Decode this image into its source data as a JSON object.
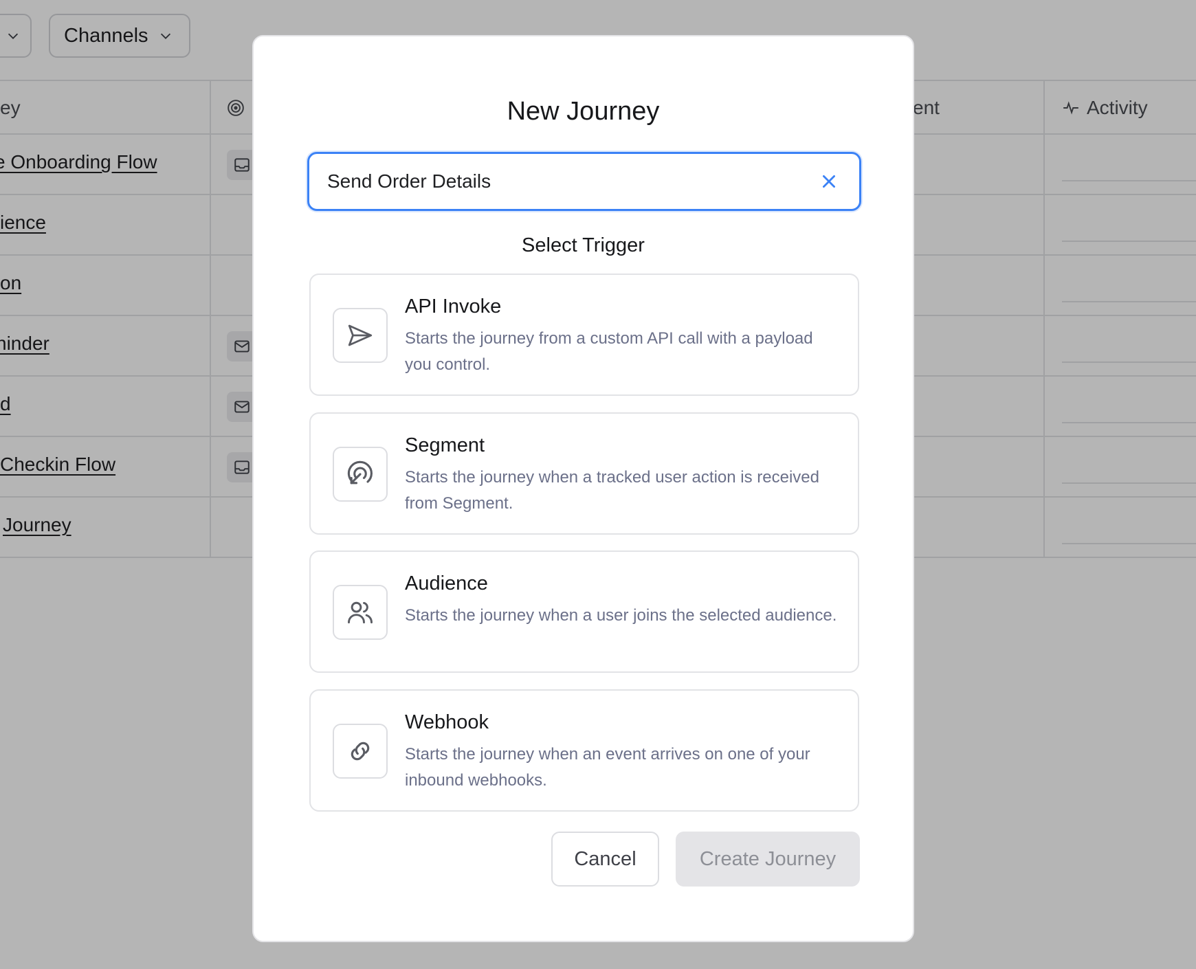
{
  "filters": {
    "channels_label": "Channels"
  },
  "table": {
    "headers": {
      "journey_partial": "ey",
      "engagement_partial": "ent",
      "activity": "Activity"
    },
    "rows": [
      {
        "name": "e Onboarding Flow",
        "icon": "inbox-icon"
      },
      {
        "name": "ience",
        "icon": ""
      },
      {
        "name": "on",
        "icon": ""
      },
      {
        "name": "ninder",
        "icon": "mail-icon"
      },
      {
        "name": "d",
        "icon": "mail-icon"
      },
      {
        "name": "Checkin Flow",
        "icon": "inbox-icon"
      },
      {
        "name": "Journey",
        "icon": ""
      }
    ]
  },
  "modal": {
    "title": "New Journey",
    "name_input": {
      "value": "Send Order Details",
      "placeholder": ""
    },
    "section_title": "Select Trigger",
    "triggers": [
      {
        "title": "API Invoke",
        "description": "Starts the journey from a custom API call with a payload you control.",
        "icon": "send-icon"
      },
      {
        "title": "Segment",
        "description": "Starts the journey when a tracked user action is received from Segment.",
        "icon": "segment-icon"
      },
      {
        "title": "Audience",
        "description": "Starts the journey when a user joins the selected audience.",
        "icon": "users-icon"
      },
      {
        "title": "Webhook",
        "description": "Starts the journey when an event arrives on one of your inbound webhooks.",
        "icon": "link-icon"
      }
    ],
    "cancel_label": "Cancel",
    "create_label": "Create Journey"
  },
  "colors": {
    "accent": "#3b82f6",
    "overlay": "#000000"
  }
}
